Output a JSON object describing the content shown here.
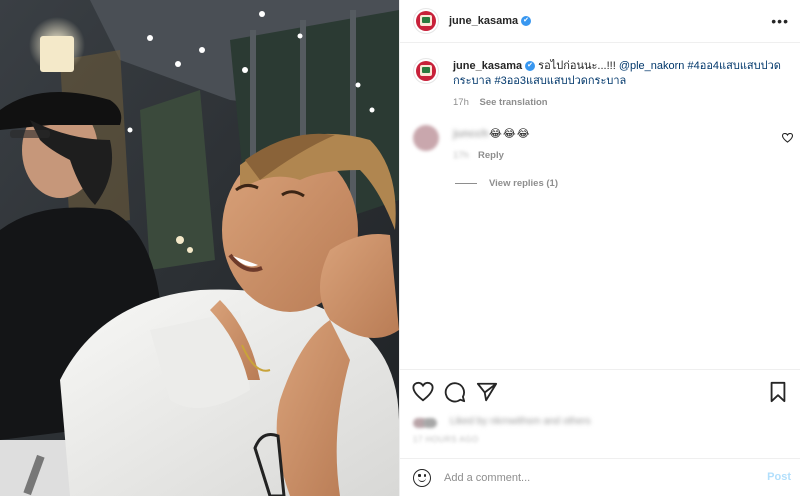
{
  "post": {
    "username": "june_kasama",
    "verified_mark": "✔",
    "more_icon": "more-horizontal-icon",
    "caption": {
      "username": "june_kasama",
      "text": "รอไปก่อนนะ...!!! ",
      "mention": "@ple_nakorn",
      "hashtag1": "#4ออ4แสบแสบปวดกระบาล",
      "hashtag2": "#3ออ3แสบแสบปวดกระบาล",
      "time": "17h",
      "see_translation": "See translation"
    },
    "comment": {
      "username": "juncch",
      "emoji": "😂😂😂",
      "time": "17h",
      "reply_label": "Reply"
    },
    "view_replies": "View replies (1)",
    "liked_by": "Liked by nkrnwithsm and others",
    "post_time": "17 HOURS AGO",
    "add_comment_placeholder": "Add a comment...",
    "post_label": "Post",
    "accent_color": "#0095f6",
    "icons": [
      "heart-icon",
      "comment-icon",
      "share-icon",
      "bookmark-icon",
      "emoji-icon"
    ]
  }
}
